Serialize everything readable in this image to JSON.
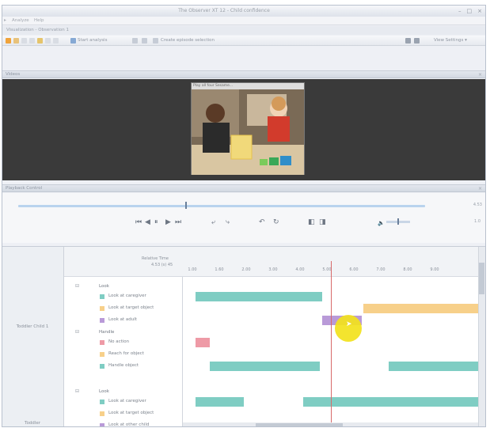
{
  "window": {
    "title": "The Observer XT 12 - Child confidence",
    "controls": [
      "–",
      "□",
      "×"
    ]
  },
  "menu": {
    "items": [
      "Analyze",
      "Help"
    ]
  },
  "document_tab": {
    "label": "Visualization - Observation 1"
  },
  "toolbar": {
    "start_label": "Start analysis",
    "action_label": "Create episode selection",
    "view_settings_label": "View Settings ▾"
  },
  "panels": {
    "video_title": "Videos",
    "playback_title": "Playback Control",
    "pin": "×"
  },
  "video": {
    "caption": "Play all four Sesame..."
  },
  "playback": {
    "time_display": "4.53",
    "speed_display": "1.0",
    "progress_fraction": 0.41,
    "volume_fraction": 0.45
  },
  "timeline": {
    "relative_time_label": "Relative Time",
    "current_time": "4.53 (s) 45",
    "ticks": [
      "1.00",
      "1.60",
      "2.00",
      "3.00",
      "4.00",
      "5.00",
      "6.00",
      "7.00",
      "8.00",
      "9.00"
    ],
    "subjects": [
      "Toddler Child 1",
      "Toddler"
    ],
    "groups": [
      {
        "title": "Look",
        "toggle": "⊟",
        "rows": [
          {
            "label": "Look at caregiver",
            "color": "#7fcdc3"
          },
          {
            "label": "Look at target object",
            "color": "#f7d08a"
          },
          {
            "label": "Look at adult",
            "color": "#b99ad8"
          }
        ]
      },
      {
        "title": "Handle",
        "toggle": "⊟",
        "rows": [
          {
            "label": "No action",
            "color": "#ee9aa6"
          },
          {
            "label": "Reach for object",
            "color": "#f7d08a"
          },
          {
            "label": "Handle object",
            "color": "#7fcdc3"
          }
        ]
      },
      {
        "title": "Look",
        "toggle": "⊟",
        "rows": [
          {
            "label": "Look at caregiver",
            "color": "#7fcdc3"
          },
          {
            "label": "Look at target object",
            "color": "#f7d08a"
          },
          {
            "label": "Look at other child",
            "color": "#b99ad8"
          }
        ]
      }
    ]
  }
}
